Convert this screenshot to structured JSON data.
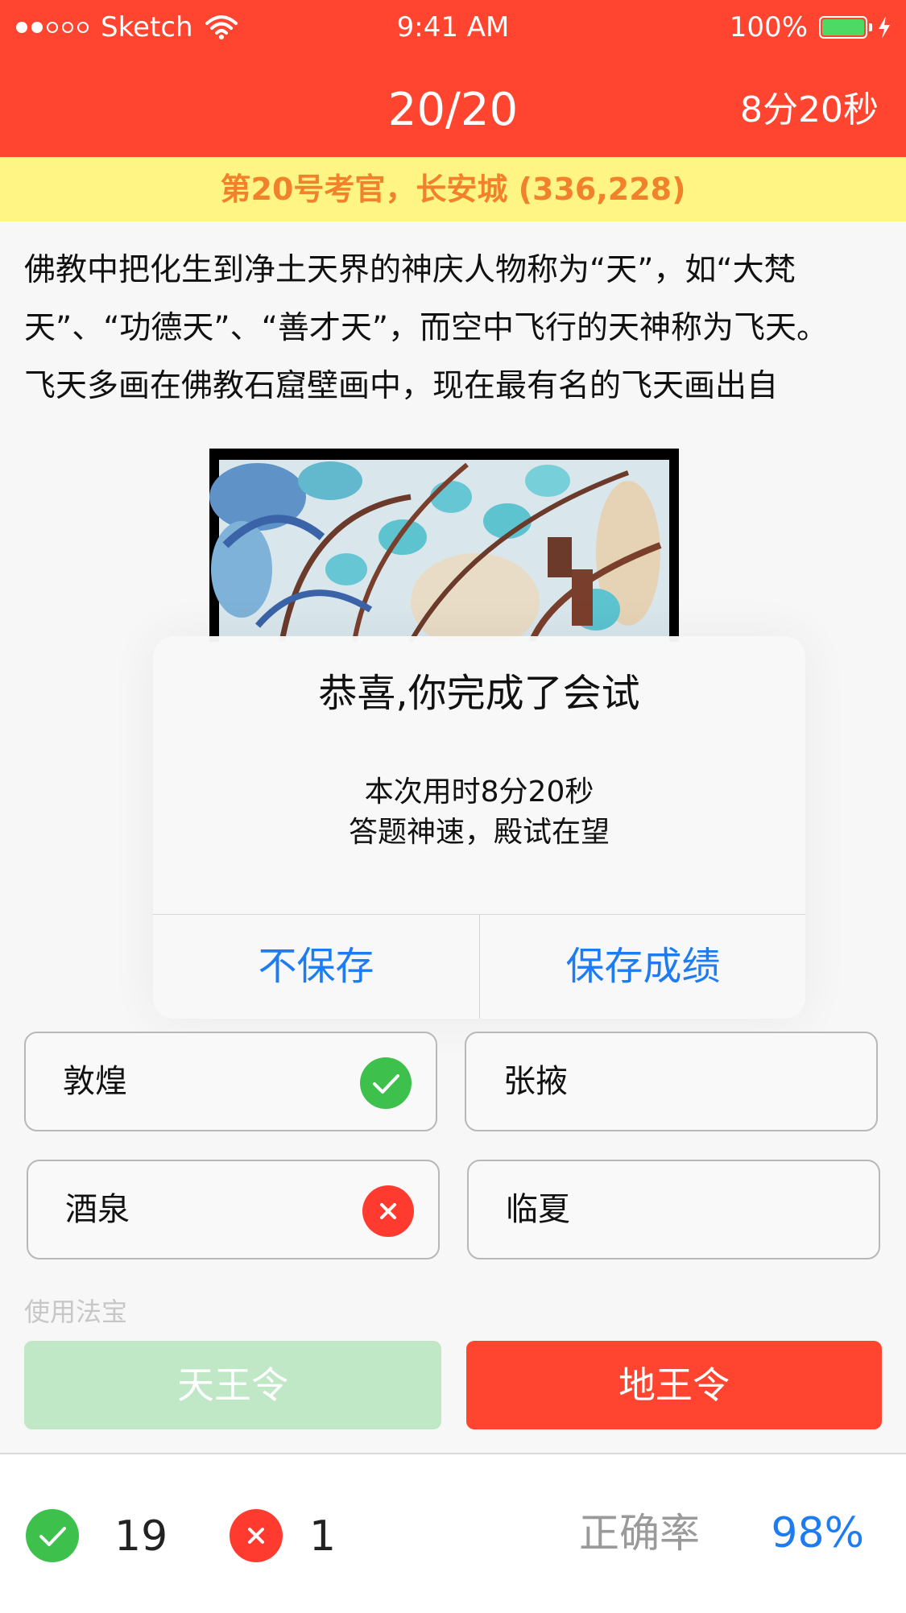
{
  "status_bar": {
    "carrier": "Sketch",
    "time": "9:41 AM",
    "battery": "100%"
  },
  "header": {
    "progress": "20/20",
    "timer": "8分20秒"
  },
  "banner": {
    "text": "第20号考官，长安城 (336,228)"
  },
  "question": {
    "lines": [
      "佛教中把化生到净土天界的神庆人物称为“天”，如“大梵",
      "天”、“功德天”、“善才天”，而空中飞行的天神称为飞天。",
      "飞天多画在佛教石窟壁画中，现在最有名的飞天画出自"
    ]
  },
  "dialog": {
    "title": "恭喜,你完成了会试",
    "message_line1": "本次用时8分20秒",
    "message_line2": "答题神速，殿试在望",
    "cancel_label": "不保存",
    "confirm_label": "保存成绩"
  },
  "answers": [
    {
      "label": "敦煌",
      "state": "correct"
    },
    {
      "label": "张掖",
      "state": "none"
    },
    {
      "label": "酒泉",
      "state": "wrong"
    },
    {
      "label": "临夏",
      "state": "none"
    }
  ],
  "tools": {
    "label": "使用法宝",
    "items": [
      {
        "label": "天王令",
        "enabled": false
      },
      {
        "label": "地王令",
        "enabled": true
      }
    ]
  },
  "footer": {
    "correct_count": "19",
    "wrong_count": "1",
    "accuracy_label": "正确率",
    "accuracy_value": "98%"
  },
  "colors": {
    "header_red": "#ff4530",
    "banner_yellow": "#fff585",
    "banner_text": "#f2812b",
    "link_blue": "#1e7cf2",
    "correct_green": "#3dc04c",
    "wrong_red": "#ff3b30"
  }
}
